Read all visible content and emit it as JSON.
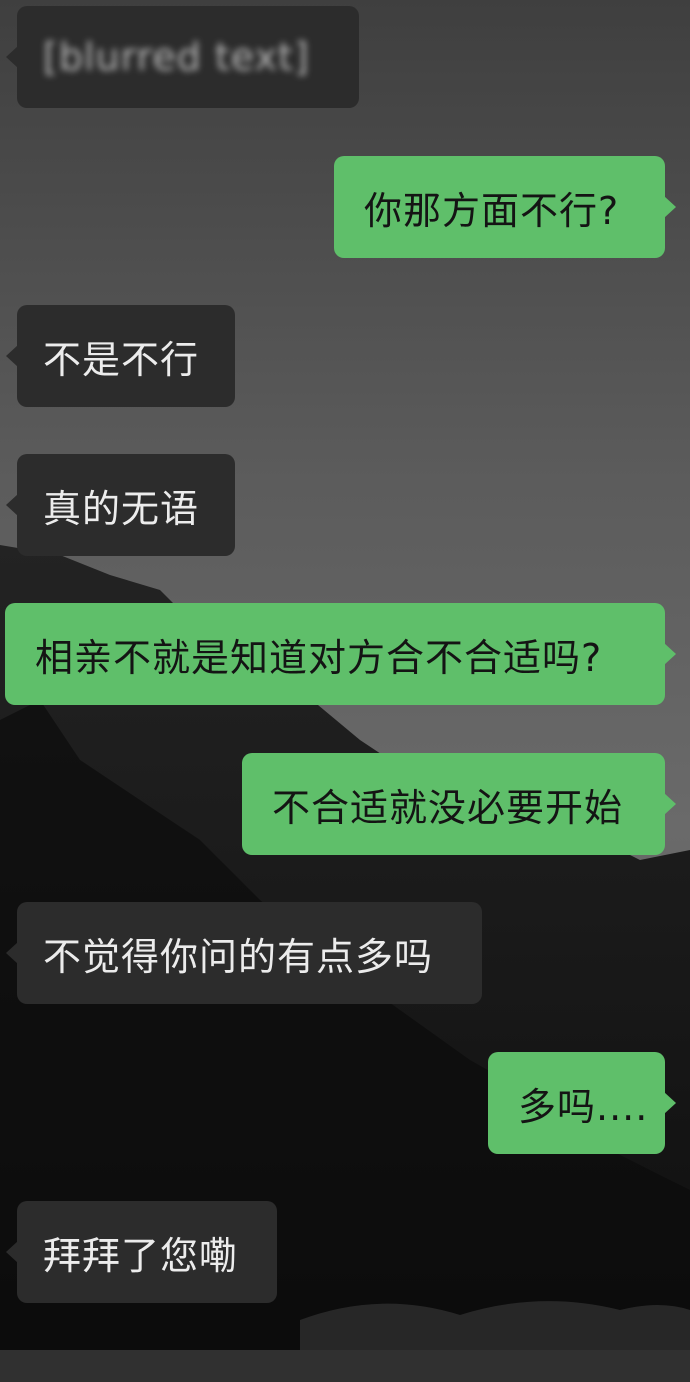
{
  "chat": {
    "messages": [
      {
        "id": "m1",
        "side": "in",
        "text": "[blurred text]",
        "blurred": true
      },
      {
        "id": "m2",
        "side": "out",
        "text": "你那方面不行?"
      },
      {
        "id": "m3",
        "side": "in",
        "text": "不是不行"
      },
      {
        "id": "m4",
        "side": "in",
        "text": "真的无语"
      },
      {
        "id": "m5",
        "side": "out",
        "text": "相亲不就是知道对方合不合适吗?"
      },
      {
        "id": "m6",
        "side": "out",
        "text": "不合适就没必要开始"
      },
      {
        "id": "m7",
        "side": "in",
        "text": "不觉得你问的有点多吗"
      },
      {
        "id": "m8",
        "side": "out",
        "text": "多吗...."
      },
      {
        "id": "m9",
        "side": "in",
        "text": "拜拜了您嘞"
      }
    ]
  },
  "colors": {
    "incoming_bubble": "#2c2c2c",
    "outgoing_bubble": "#5fbf6a",
    "background_sky": "#5a5a5a",
    "mountain": "#141414"
  }
}
